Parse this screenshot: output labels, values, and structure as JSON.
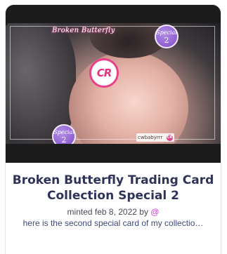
{
  "card": {
    "image": {
      "frame_caption": "Broken Butterfly",
      "logo_text": "CR",
      "badge_top": {
        "line1": "Special",
        "line2": "2"
      },
      "badge_bottom": {
        "line1": "Special",
        "line2": "2"
      },
      "watermark_text": "cwbabyrrr",
      "watermark_logo": "CR"
    },
    "title": "Broken Butterfly Trading Card Collection Special 2",
    "minted_prefix": "minted feb 8, 2022 by ",
    "creator_handle": "@",
    "description": "here is the second special card of my collectio…"
  },
  "colors": {
    "title": "#2f3259",
    "handle": "#d13ad6",
    "description": "#3f4a7a",
    "logo_accent": "#ea3f8b",
    "badge_purple": "#8e5fd1"
  }
}
